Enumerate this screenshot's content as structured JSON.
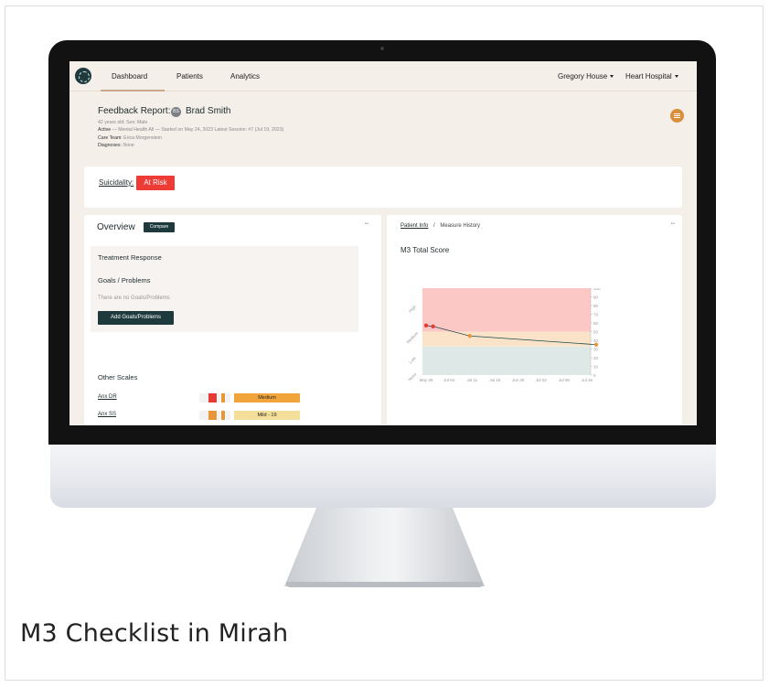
{
  "caption": "M3 Checklist in Mirah",
  "nav": {
    "items": [
      "Dashboard",
      "Patients",
      "Analytics"
    ],
    "user": "Gregory House",
    "org": "Heart Hospital"
  },
  "patient": {
    "report_label": "Feedback Report:",
    "avatar_initials": "BS",
    "name": "Brad Smith",
    "demographics": "42 years old; Sex: Male",
    "status": "Active",
    "program_line": " — Mental Health All — Started on May 24, 2023  Latest Session: #7 (Jul 19, 2023)",
    "care_team_label": "Care Team:",
    "care_team": "Erica Morgenstein",
    "diagnoses_label": "Diagnoses:",
    "diagnoses": "None"
  },
  "suicidality": {
    "label": "Suicidality:",
    "status": "At Risk"
  },
  "overview": {
    "title": "Overview",
    "compare_label": "Compare",
    "expand_icon": "↔",
    "treatment_response": "Treatment Response",
    "goals_title": "Goals / Problems",
    "goals_empty": "There are no Goals/Problems",
    "add_goals": "Add Goals/Problems",
    "other_scales": "Other Scales",
    "scales": [
      {
        "name": "Anx DR",
        "severity": "Medium",
        "color": "#f0a43a"
      },
      {
        "name": "Anx SS",
        "severity": "Mild - 19",
        "color": "#f3df9a"
      }
    ]
  },
  "history": {
    "breadcrumb_link": "Patient Info",
    "separator": "/",
    "breadcrumb_current": "Measure History",
    "expand_icon": "↔"
  },
  "chart_data": {
    "type": "line",
    "title": "M3 Total Score",
    "x": [
      "May 28",
      "Jul 04",
      "Jul 11",
      "Jul 18",
      "Jun 25",
      "Jul 02",
      "Jul 09",
      "Jul 16"
    ],
    "ylim": [
      0,
      100
    ],
    "yticks": [
      0,
      10,
      20,
      30,
      40,
      50,
      60,
      70,
      80,
      90,
      100
    ],
    "bands": [
      {
        "label": "None",
        "from": 0,
        "to": 0,
        "color": "#dfe9e8"
      },
      {
        "label": "Low",
        "from": 0,
        "to": 33,
        "color": "#dde8e7"
      },
      {
        "label": "Medium",
        "from": 33,
        "to": 50,
        "color": "#fbe3c9"
      },
      {
        "label": "High",
        "from": 50,
        "to": 100,
        "color": "#fbc8c6"
      }
    ],
    "series": [
      {
        "points": [
          {
            "x": 0.0,
            "y": 57,
            "color": "#e63b35"
          },
          {
            "x": 0.3,
            "y": 56,
            "color": "#e63b35"
          },
          {
            "x": 1.9,
            "y": 45,
            "color": "#e9963a"
          },
          {
            "x": 7.4,
            "y": 35,
            "color": "#e9963a"
          }
        ]
      }
    ],
    "grid": false
  }
}
